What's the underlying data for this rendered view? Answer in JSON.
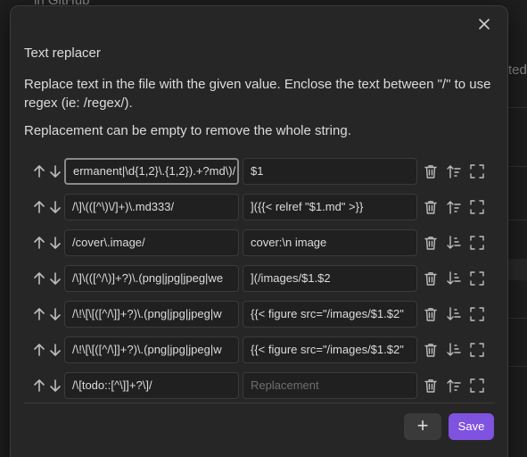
{
  "background": {
    "top_left_text": "in GitHub",
    "right_text": "ted"
  },
  "modal": {
    "title": "Text replacer",
    "description": "Replace text in the file with the given value. Enclose the text between \"/\" to use regex (ie: /regex/).",
    "note": "Replacement can be empty to remove the whole string.",
    "rows": [
      {
        "pattern": "ermanent|\\d{1,2}\\.{1,2}).+?md\\)/",
        "replacement": "$1",
        "sort_direction": "ascending"
      },
      {
        "pattern": "/\\]\\(([^\\)\\/]+)\\.md333/",
        "replacement": "]({{< relref \"$1.md\" >}}",
        "sort_direction": "ascending"
      },
      {
        "pattern": "/cover\\.image/",
        "replacement": "cover:\\n    image",
        "sort_direction": "descending"
      },
      {
        "pattern": "/\\]\\(([^/\\)]+?)\\.(png|jpg|jpeg|we",
        "replacement": "](/images/$1.$2",
        "sort_direction": "descending"
      },
      {
        "pattern": "/\\!\\[\\[([^/\\]]+?)\\.(png|jpg|jpeg|w",
        "replacement": "{{< figure src=\"/images/$1.$2\"",
        "sort_direction": "descending"
      },
      {
        "pattern": "/\\!\\[\\[([^/\\]]+?)\\.(png|jpg|jpeg|w",
        "replacement": "{{< figure src=\"/images/$1.$2\"",
        "sort_direction": "descending"
      },
      {
        "pattern": "/\\[todo::[^\\]]+?\\]/",
        "replacement": "",
        "replacement_placeholder": "Replacement",
        "sort_direction": "ascending"
      }
    ],
    "add_label": "+",
    "save_label": "Save",
    "accent_color": "#7f52e0"
  },
  "icons": {
    "close": "close-icon",
    "up": "arrow-up-icon",
    "down": "arrow-down-icon",
    "trash": "trash-icon",
    "sort": "sort-icon",
    "expand": "expand-icon"
  }
}
